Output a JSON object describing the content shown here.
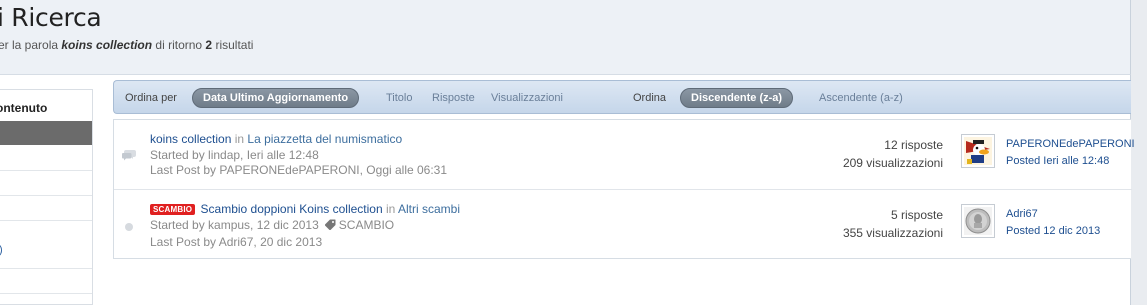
{
  "header": {
    "title": "i Ricerca",
    "subtitle_pre": "er la parola ",
    "query": "koins collection",
    "subtitle_mid": " di ritorno ",
    "count": "2",
    "subtitle_post": " risultati"
  },
  "sidebar": {
    "title": "ontenuto",
    "partial_text": ")"
  },
  "sortbar": {
    "order_by_label": "Ordina per",
    "active_sort": "Data Ultimo Aggiornamento",
    "sort_options": [
      "Titolo",
      "Risposte",
      "Visualizzazioni"
    ],
    "order_label": "Ordina",
    "active_order": "Discendente (z-a)",
    "order_option": "Ascendente (a-z)"
  },
  "results": [
    {
      "status_icon": "speech-bubbles-icon",
      "title": "koins collection",
      "in_text": "in",
      "forum": "La piazzetta del numismatico",
      "started_by": "Started by lindap, Ieri alle 12:48",
      "last_post": "Last Post by PAPERONEdePAPERONI, Oggi alle 06:31",
      "replies": "12 risposte",
      "views": "209 visualizzazioni",
      "poster_name": "PAPERONEdePAPERONI",
      "posted": "Posted Ieri alle 12:48",
      "avatar": "duck-avatar-icon"
    },
    {
      "status_icon": "grey-dot-icon",
      "prefix": "SCAMBIO",
      "title": "Scambio doppioni Koins collection",
      "in_text": "in",
      "forum": "Altri scambi",
      "started_by": "Started by kampus, 12 dic 2013",
      "tag_icon": "tag-icon",
      "tag": "SCAMBIO",
      "last_post": "Last Post by Adri67, 20 dic 2013",
      "replies": "5 risposte",
      "views": "355 visualizzazioni",
      "poster_name": "Adri67",
      "posted": "Posted 12 dic 2013",
      "avatar": "coin-avatar-icon"
    }
  ],
  "colors": {
    "link": "#1e4f90",
    "prefix_badge": "#e02020",
    "sortbar": "#c5d6ea"
  }
}
